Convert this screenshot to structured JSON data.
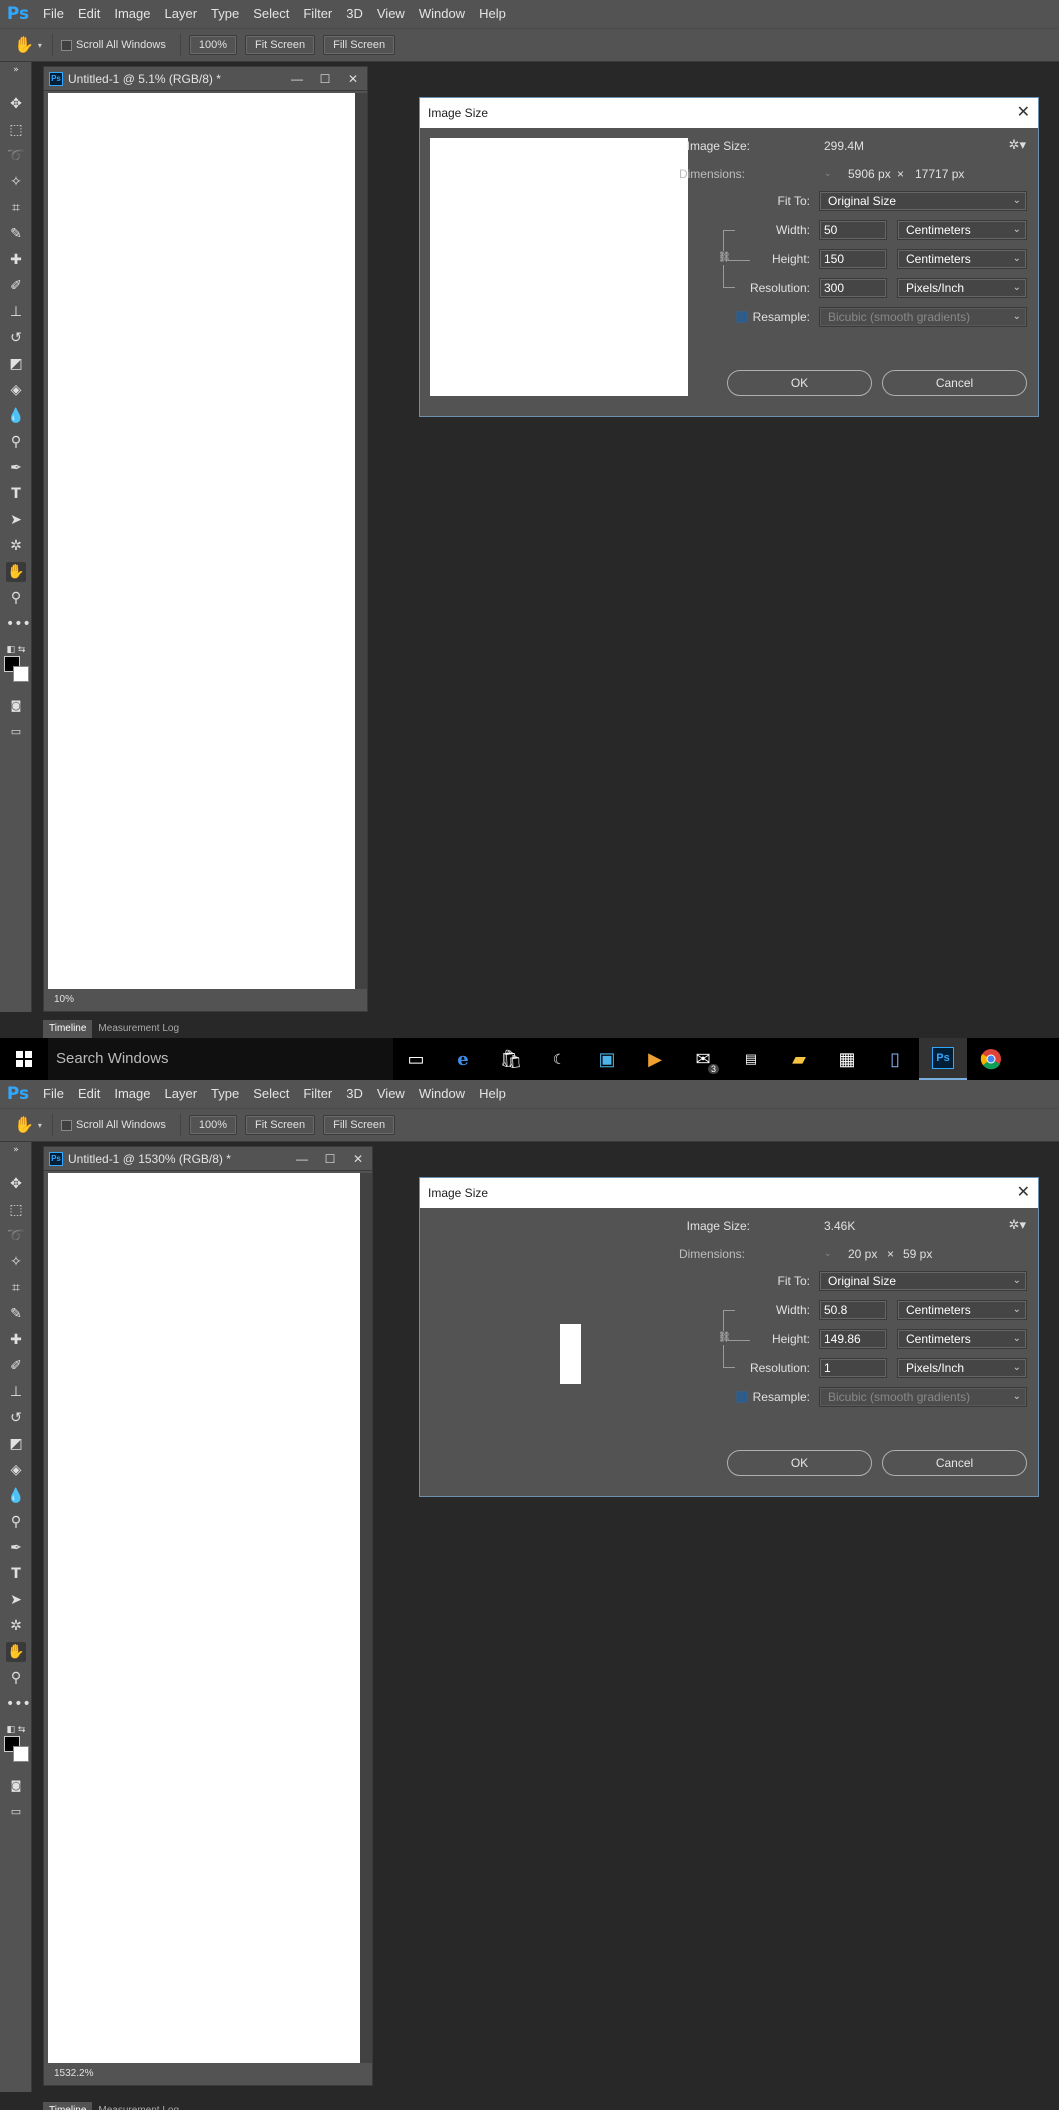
{
  "app": {
    "logo": "Ps",
    "menu": [
      "File",
      "Edit",
      "Image",
      "Layer",
      "Type",
      "Select",
      "Filter",
      "3D",
      "View",
      "Window",
      "Help"
    ]
  },
  "options": {
    "scroll_all_windows": "Scroll All Windows",
    "zoom_100": "100%",
    "fit_screen": "Fit Screen",
    "fill_screen": "Fill Screen"
  },
  "shot1": {
    "doc_title": "Untitled-1 @ 5.1% (RGB/8) *",
    "zoom_status": "10%",
    "tabs": {
      "timeline": "Timeline",
      "measurement": "Measurement Log"
    },
    "dialog": {
      "title": "Image Size",
      "image_size_label": "Image Size:",
      "image_size": "299.4M",
      "dimensions_label": "Dimensions:",
      "dim_w": "5906 px",
      "times": "×",
      "dim_h": "17717 px",
      "fit_label": "Fit To:",
      "fit_value": "Original Size",
      "width_label": "Width:",
      "width": "50",
      "width_unit": "Centimeters",
      "height_label": "Height:",
      "height": "150",
      "height_unit": "Centimeters",
      "res_label": "Resolution:",
      "resolution": "300",
      "res_unit": "Pixels/Inch",
      "resample_label": "Resample:",
      "resample_value": "Bicubic (smooth gradients)",
      "ok": "OK",
      "cancel": "Cancel"
    }
  },
  "taskbar": {
    "search": "Search Windows",
    "mail_badge": "3",
    "icons": [
      "task-view",
      "edge",
      "store",
      "app",
      "photos",
      "media",
      "mail",
      "terminal",
      "file-explorer",
      "calculator",
      "notepad",
      "photoshop",
      "chrome"
    ]
  },
  "shot2": {
    "doc_title": "Untitled-1 @ 1530% (RGB/8) *",
    "zoom_status": "1532.2%",
    "tabs": {
      "timeline": "Timeline",
      "measurement": "Measurement Log"
    },
    "dialog": {
      "title": "Image Size",
      "image_size_label": "Image Size:",
      "image_size": "3.46K",
      "dimensions_label": "Dimensions:",
      "dim_w": "20 px",
      "times": "×",
      "dim_h": "59 px",
      "fit_label": "Fit To:",
      "fit_value": "Original Size",
      "width_label": "Width:",
      "width": "50.8",
      "width_unit": "Centimeters",
      "height_label": "Height:",
      "height": "149.86",
      "height_unit": "Centimeters",
      "res_label": "Resolution:",
      "resolution": "1",
      "res_unit": "Pixels/Inch",
      "resample_label": "Resample:",
      "resample_value": "Bicubic (smooth gradients)",
      "ok": "OK",
      "cancel": "Cancel"
    }
  }
}
